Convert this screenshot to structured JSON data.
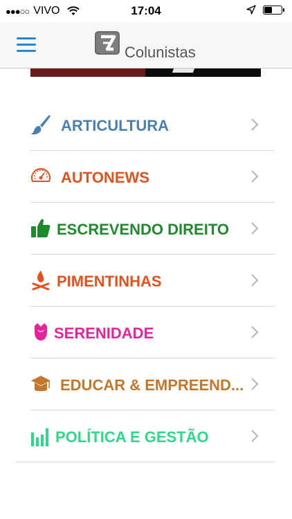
{
  "status_bar": {
    "signal": "●●●○○",
    "carrier": "VIVO",
    "time": "17:04",
    "battery_level": 0.45,
    "icons": [
      "wifi-icon",
      "location-arrow-icon",
      "battery-icon"
    ]
  },
  "nav": {
    "title": "Colunistas",
    "menu_icon": "hamburger-menu-icon",
    "logo": "app-logo",
    "accent_color": "#2f84c7"
  },
  "menu": {
    "items": [
      {
        "label": "ARTICULTURA",
        "color": "#4a7fae",
        "icon": "paintbrush-icon"
      },
      {
        "label": "AUTONEWS",
        "color": "#e0531f",
        "icon": "speedometer-icon"
      },
      {
        "label": "ESCREVENDO DIREITO",
        "color": "#1f8a2c",
        "icon": "thumbs-up-icon"
      },
      {
        "label": "PIMENTINHAS",
        "color": "#e8501e",
        "icon": "campfire-icon"
      },
      {
        "label": "SERENIDADE",
        "color": "#e6249a",
        "icon": "rose-icon"
      },
      {
        "label": "EDUCAR & EMPREEND...",
        "color": "#c4762b",
        "icon": "graduation-cap-icon"
      },
      {
        "label": "POLÍTICA E GESTÃO",
        "color": "#2fd88a",
        "icon": "bar-chart-icon"
      }
    ],
    "chevron_icon": "chevron-right-icon"
  }
}
